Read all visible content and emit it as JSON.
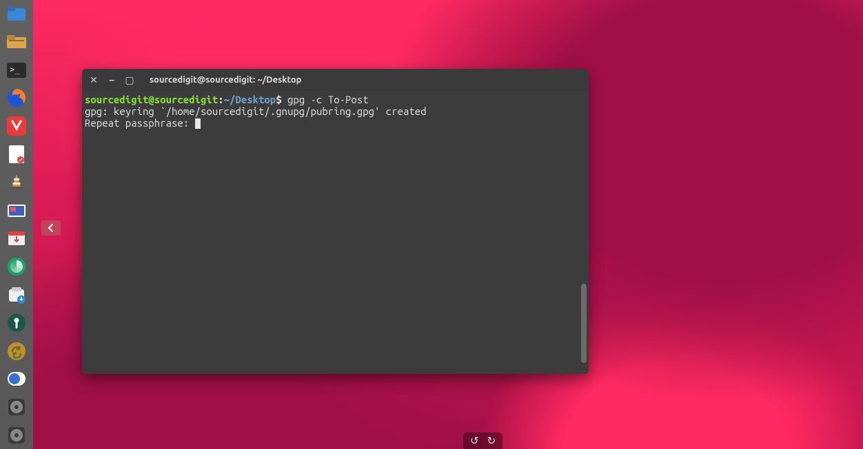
{
  "dock": [
    {
      "name": "files-icon"
    },
    {
      "name": "file-manager-icon"
    },
    {
      "name": "terminal-icon"
    },
    {
      "name": "firefox-icon"
    },
    {
      "name": "vivaldi-icon"
    },
    {
      "name": "notes-icon"
    },
    {
      "name": "vlc-icon"
    },
    {
      "name": "screenshot-icon"
    },
    {
      "name": "software-updater-icon"
    },
    {
      "name": "shutter-icon"
    },
    {
      "name": "software-install-icon"
    },
    {
      "name": "settings-gear-icon"
    },
    {
      "name": "sync-icon"
    },
    {
      "name": "tweaks-icon"
    },
    {
      "name": "disc-icon-1"
    },
    {
      "name": "disc-icon-2"
    }
  ],
  "reveal_arrow": {
    "title": "Reveal"
  },
  "terminal": {
    "title": "sourcedigit@sourcedigit: ~/Desktop",
    "prompt": {
      "user": "sourcedigit@sourcedigit",
      "colon": ":",
      "path": "~/Desktop",
      "dollar": "$"
    },
    "command": " gpg -c To-Post",
    "output_line": "gpg: keyring `/home/sourcedigit/.gnupg/pubring.gpg' created",
    "prompt2": "Repeat passphrase: "
  },
  "bottom": {
    "undo": "↺",
    "redo": "↻"
  }
}
